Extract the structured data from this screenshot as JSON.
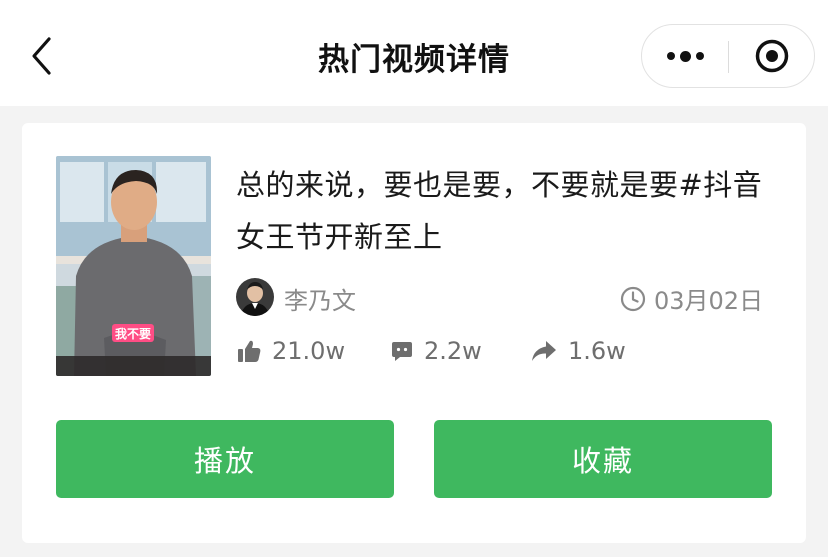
{
  "nav": {
    "title": "热门视频详情",
    "back_icon": "chevron-left-icon",
    "more_icon": "more-dots-icon",
    "close_icon": "target-close-icon"
  },
  "video": {
    "title": "总的来说，要也是要，不要就是要#抖音女王节开新至上",
    "thumbnail_caption": "我不要",
    "author": {
      "name": "李乃文",
      "avatar_icon": "avatar"
    },
    "date": "03月02日",
    "stats": {
      "likes": "21.0w",
      "comments": "2.2w",
      "shares": "1.6w"
    }
  },
  "actions": {
    "play_label": "播放",
    "favorite_label": "收藏"
  },
  "colors": {
    "accent_green": "#3fb85f",
    "page_bg": "#f3f3f3",
    "muted_text": "#8a8a8a"
  }
}
